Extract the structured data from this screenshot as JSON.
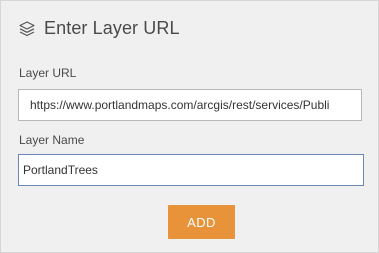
{
  "header": {
    "icon": "layers-icon",
    "title": "Enter Layer URL"
  },
  "layer_url": {
    "label": "Layer URL",
    "value": "https://www.portlandmaps.com/arcgis/rest/services/Publi"
  },
  "layer_name": {
    "label": "Layer Name",
    "value": "PortlandTrees"
  },
  "actions": {
    "add_label": "ADD",
    "add_color": "#e8923a"
  }
}
